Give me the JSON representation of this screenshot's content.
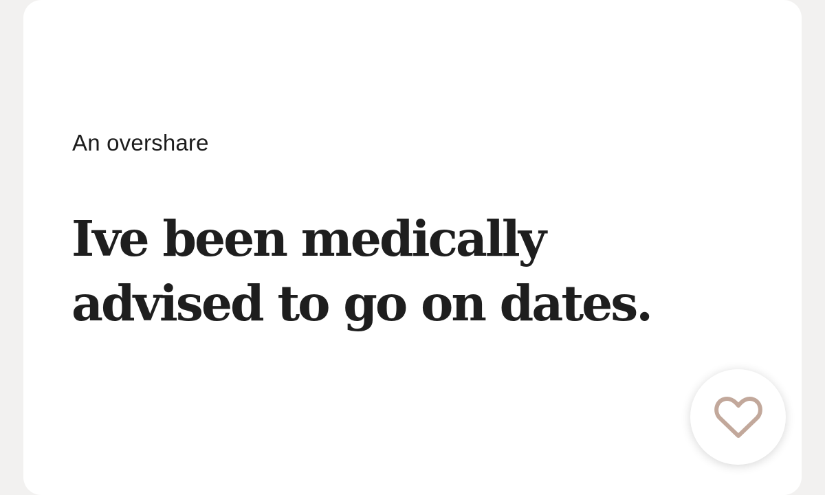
{
  "prompt_card": {
    "prompt": "An overshare",
    "answer": "Ive been medically advised to go on dates."
  },
  "like_button": {
    "icon": "heart-icon",
    "icon_color": "#c2a89b"
  },
  "colors": {
    "background": "#f2f1f0",
    "card": "#ffffff",
    "text": "#1e1e1e"
  }
}
